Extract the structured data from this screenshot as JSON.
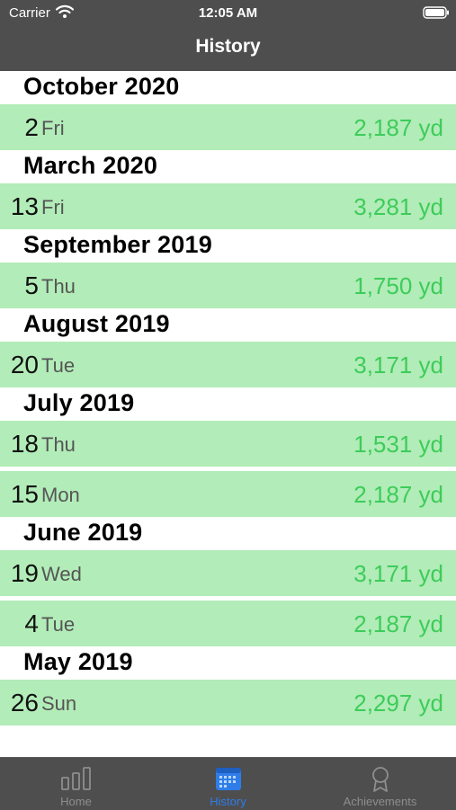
{
  "status_bar": {
    "carrier": "Carrier",
    "time": "12:05 AM"
  },
  "nav": {
    "title": "History"
  },
  "sections": [
    {
      "title": "October 2020",
      "rows": [
        {
          "day": "2",
          "weekday": "Fri",
          "distance": "2,187 yd"
        }
      ]
    },
    {
      "title": "March 2020",
      "rows": [
        {
          "day": "13",
          "weekday": "Fri",
          "distance": "3,281 yd"
        }
      ]
    },
    {
      "title": "September 2019",
      "rows": [
        {
          "day": "5",
          "weekday": "Thu",
          "distance": "1,750 yd"
        }
      ]
    },
    {
      "title": "August 2019",
      "rows": [
        {
          "day": "20",
          "weekday": "Tue",
          "distance": "3,171 yd"
        }
      ]
    },
    {
      "title": "July 2019",
      "rows": [
        {
          "day": "18",
          "weekday": "Thu",
          "distance": "1,531 yd"
        },
        {
          "day": "15",
          "weekday": "Mon",
          "distance": "2,187 yd"
        }
      ]
    },
    {
      "title": "June 2019",
      "rows": [
        {
          "day": "19",
          "weekday": "Wed",
          "distance": "3,171 yd"
        },
        {
          "day": "4",
          "weekday": "Tue",
          "distance": "2,187 yd"
        }
      ]
    },
    {
      "title": "May 2019",
      "rows": [
        {
          "day": "26",
          "weekday": "Sun",
          "distance": "2,297 yd"
        }
      ]
    }
  ],
  "tab_bar": {
    "tabs": [
      {
        "label": "Home",
        "icon": "bar-chart-icon",
        "active": false
      },
      {
        "label": "History",
        "icon": "calendar-icon",
        "active": true
      },
      {
        "label": "Achievements",
        "icon": "award-ribbon-icon",
        "active": false
      }
    ]
  },
  "colors": {
    "nav_background": "#4e4e4e",
    "row_background": "#b2ecb8",
    "distance_text": "#3dcc5a",
    "tab_active": "#2f7de8",
    "tab_inactive": "#8e8e8e"
  }
}
